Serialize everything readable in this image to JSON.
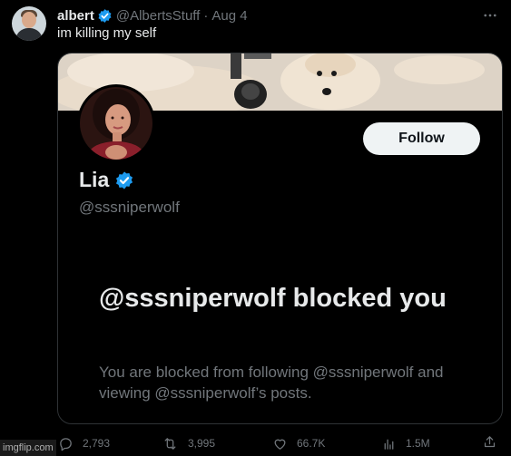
{
  "author": {
    "name": "albert",
    "handle": "@AlbertsStuff",
    "separator": "·",
    "date": "Aug 4"
  },
  "post": {
    "text": "im killing my self"
  },
  "card": {
    "profile_name": "Lia",
    "profile_handle": "@sssniperwolf",
    "follow_label": "Follow",
    "blocked_title": "@sssniperwolf blocked you",
    "blocked_body": "You are blocked from following @sssniperwolf and viewing @sssniperwolf’s posts."
  },
  "actions": {
    "replies": "2,793",
    "reposts": "3,995",
    "likes": "66.7K",
    "views": "1.5M"
  },
  "watermark": "imgflip.com",
  "colors": {
    "background": "#000000",
    "text": "#e7e9ea",
    "muted": "#71767b",
    "verified": "#1d9bf0",
    "follow_button": "#eff3f4"
  },
  "icons": [
    "verified-badge-icon",
    "more-icon",
    "reply-icon",
    "repost-icon",
    "like-icon",
    "views-icon",
    "share-icon"
  ]
}
